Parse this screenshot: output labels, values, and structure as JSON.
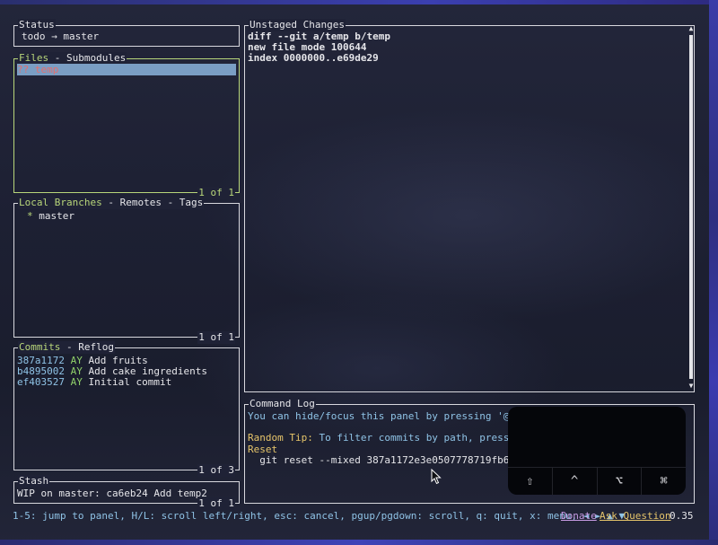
{
  "status_panel": {
    "title": "Status",
    "repo": "todo",
    "arrow": "→",
    "branch": "master"
  },
  "files_panel": {
    "title_active": "Files",
    "title_sep": " - ",
    "title_other": "Submodules",
    "items": [
      {
        "status": "??",
        "name": "temp"
      }
    ],
    "count": "1 of 1"
  },
  "branches_panel": {
    "title_active": "Local Branches",
    "title_rest": " - Remotes - Tags",
    "items": [
      {
        "marker": "*",
        "name": "master"
      }
    ],
    "count": "1 of 1"
  },
  "commits_panel": {
    "title_active": "Commits",
    "title_rest": " - Reflog",
    "items": [
      {
        "hash": "387a1172",
        "author": "AY",
        "message": "Add fruits"
      },
      {
        "hash": "b4895002",
        "author": "AY",
        "message": "Add cake ingredients"
      },
      {
        "hash": "ef403527",
        "author": "AY",
        "message": "Initial commit"
      }
    ],
    "count": "1 of 3"
  },
  "stash_panel": {
    "title": "Stash",
    "items": [
      {
        "text": "WIP on master: ca6eb24 Add temp2"
      }
    ],
    "count": "1 of 1"
  },
  "diff_panel": {
    "title": "Unstaged Changes",
    "lines": [
      "diff --git a/temp b/temp",
      "new file mode 100644",
      "index 0000000..e69de29"
    ],
    "scroll_up": "▲",
    "scroll_down": "▼"
  },
  "command_log": {
    "title": "Command Log",
    "hint": "You can hide/focus this panel by pressing '@'",
    "tip_label": "Random Tip:",
    "tip_text": " To filter commits by path, press 'ctrl+s'",
    "action": "Reset",
    "command": "  git reset --mixed 387a1172e3e0507778719fb6ebf22bc5da27d8d7"
  },
  "key_overlay": {
    "keys": [
      {
        "icon": "shift-icon",
        "glyph": "⇧"
      },
      {
        "icon": "control-icon",
        "glyph": "^"
      },
      {
        "icon": "option-icon",
        "glyph": "⌥"
      },
      {
        "icon": "command-icon",
        "glyph": "⌘"
      }
    ]
  },
  "status_bar": {
    "keybindings": "1-5: jump to panel, H/L: scroll left/right, esc: cancel, pgup/pgdown: scroll, q: quit, x: menu, ◄ ► ▲ ▼",
    "donate": "Donate",
    "ask_question": "Ask Question",
    "version": "0.35"
  },
  "colors": {
    "active_border": "#b8d67a",
    "selection": "#7a9ec4",
    "hash": "#8fc3e6",
    "author": "#8fd06a",
    "tip": "#e6c56a"
  }
}
